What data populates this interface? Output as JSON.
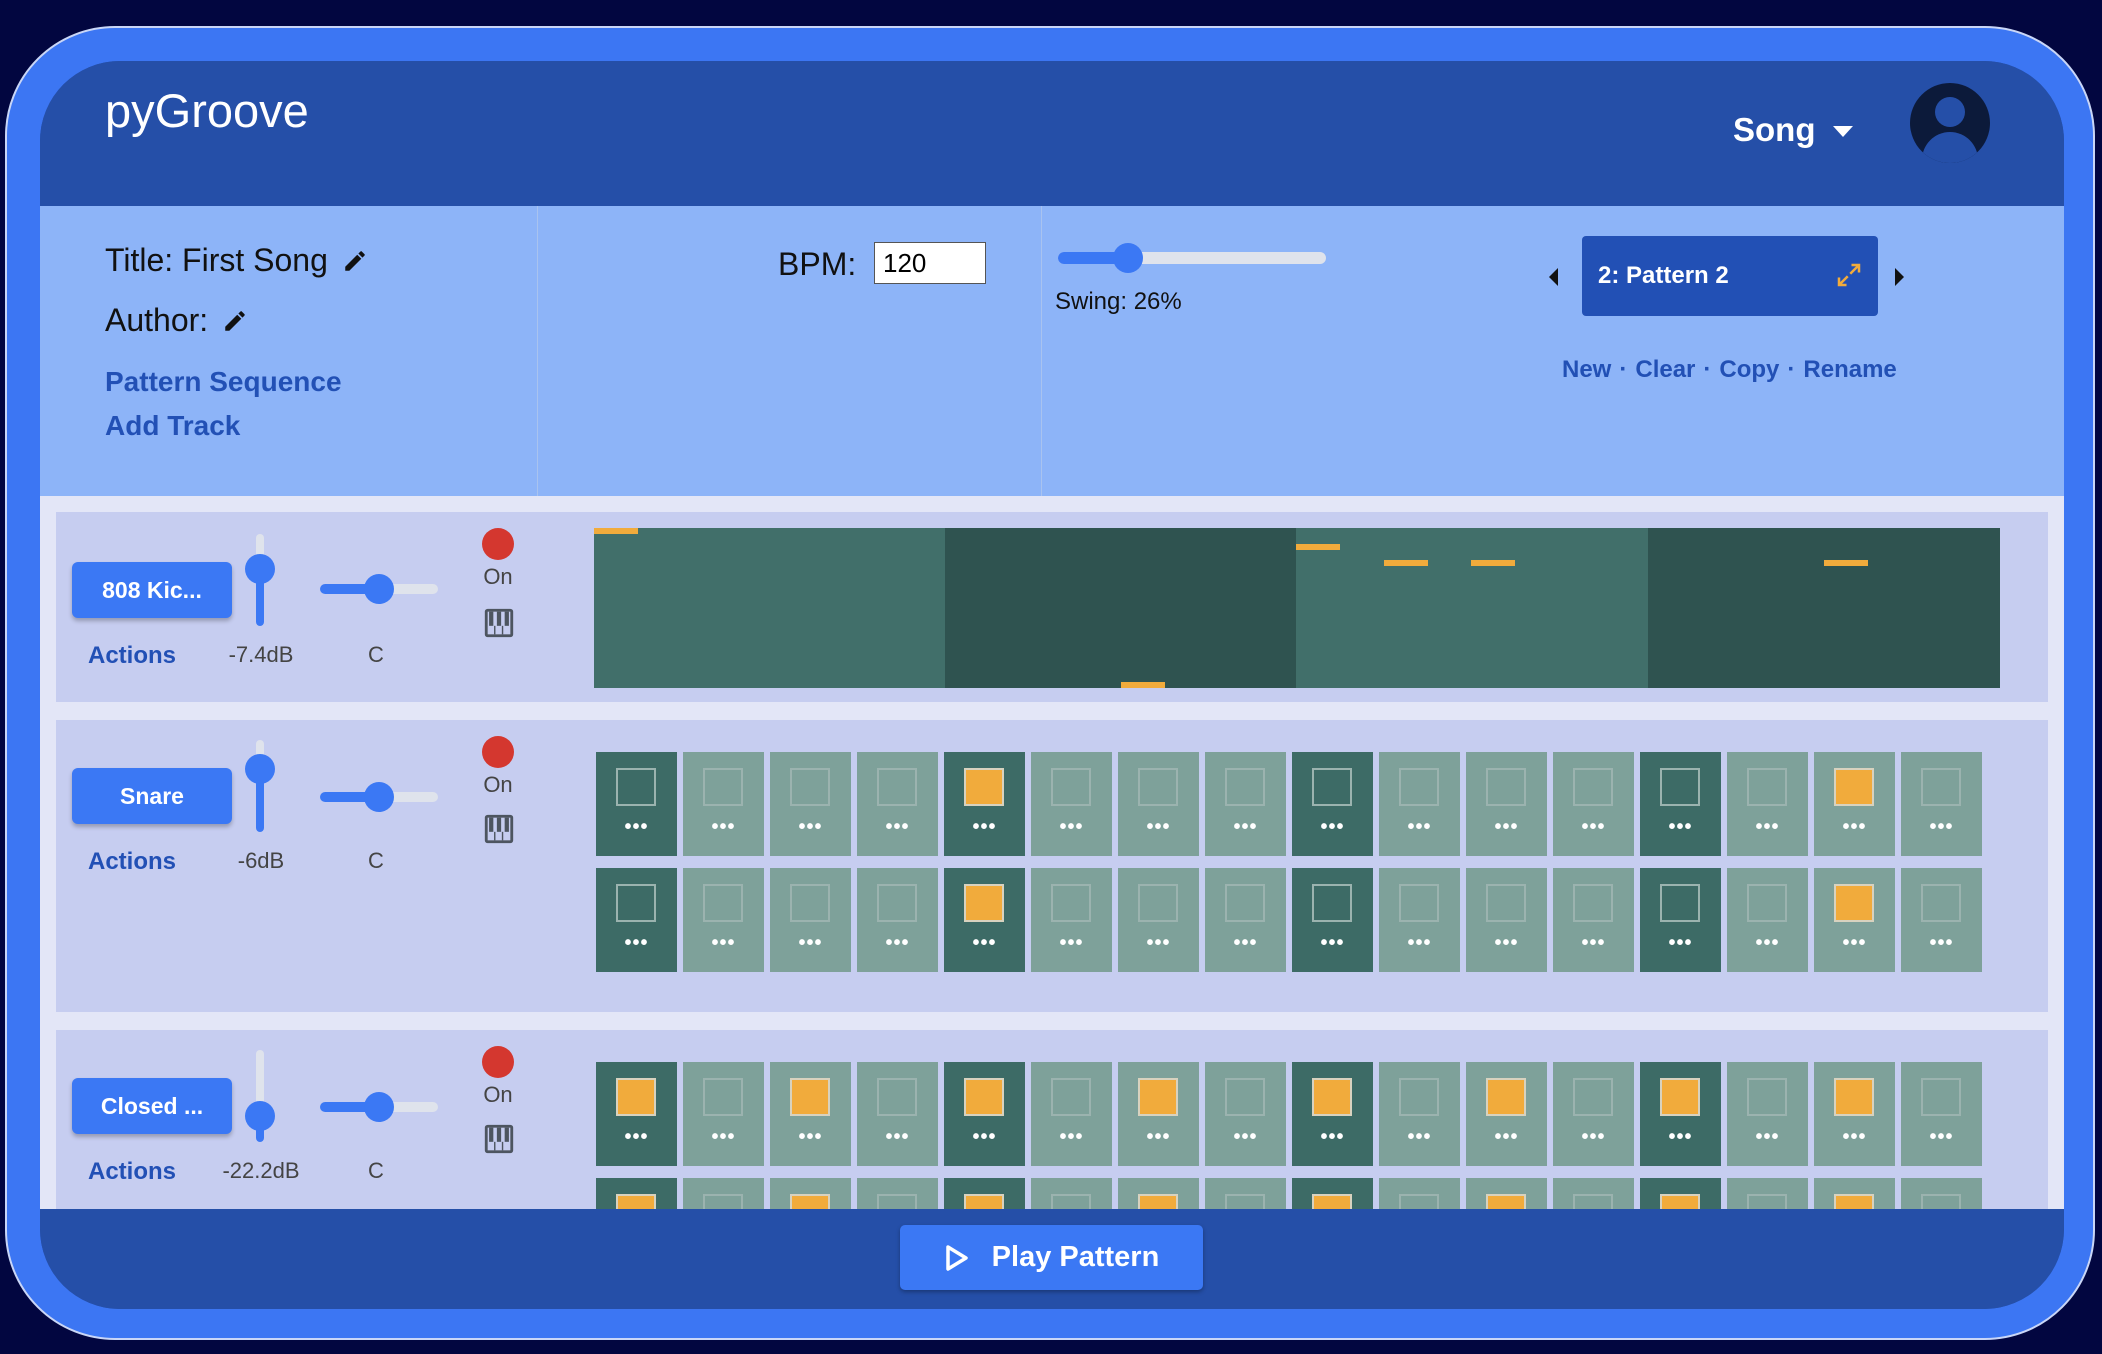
{
  "app": {
    "title": "pyGroove"
  },
  "header": {
    "menu_label": "Song",
    "avatar_icon": "account-circle-icon"
  },
  "song": {
    "title_text": "Title: First Song",
    "author_text": "Author:",
    "links": {
      "pattern_sequence": "Pattern Sequence",
      "add_track": "Add Track"
    }
  },
  "tempo": {
    "bpm_label": "BPM:",
    "bpm_value": "120",
    "swing_label": "Swing: 26%",
    "swing_fraction": 0.26
  },
  "pattern": {
    "current": "2: Pattern 2",
    "actions": [
      "New",
      "Clear",
      "Copy",
      "Rename"
    ],
    "separator": "·"
  },
  "tracks": [
    {
      "name": "808 Kic...",
      "actions_label": "Actions",
      "volume_label": "-7.4dB",
      "volume_level": 0.62,
      "pan_label": "C",
      "pan_level": 0.5,
      "on_label": "On",
      "view": "piano-roll"
    },
    {
      "name": "Snare",
      "actions_label": "Actions",
      "volume_label": "-6dB",
      "volume_level": 0.68,
      "pan_label": "C",
      "pan_level": 0.5,
      "on_label": "On",
      "view": "steps",
      "rows": [
        [
          0,
          0,
          0,
          0,
          1,
          0,
          0,
          0,
          0,
          0,
          0,
          0,
          0,
          0,
          1,
          0
        ],
        [
          0,
          0,
          0,
          0,
          1,
          0,
          0,
          0,
          0,
          0,
          0,
          0,
          0,
          0,
          1,
          0
        ]
      ]
    },
    {
      "name": "Closed ...",
      "actions_label": "Actions",
      "volume_label": "-22.2dB",
      "volume_level": 0.28,
      "pan_label": "C",
      "pan_level": 0.5,
      "on_label": "On",
      "view": "steps",
      "rows": [
        [
          1,
          0,
          1,
          0,
          1,
          0,
          1,
          0,
          1,
          0,
          1,
          0,
          1,
          0,
          1,
          0
        ],
        [
          1,
          0,
          1,
          0,
          1,
          0,
          1,
          0,
          1,
          0,
          1,
          0,
          1,
          0,
          1,
          0
        ]
      ]
    }
  ],
  "step_dots": "•••",
  "footer": {
    "play_label": "Play Pattern"
  },
  "colors": {
    "accent": "#3b78f4",
    "active_step": "#f1ab3c",
    "step_dark": "#3d6b66",
    "step_light": "#7ea19a",
    "record": "#d4372f"
  }
}
